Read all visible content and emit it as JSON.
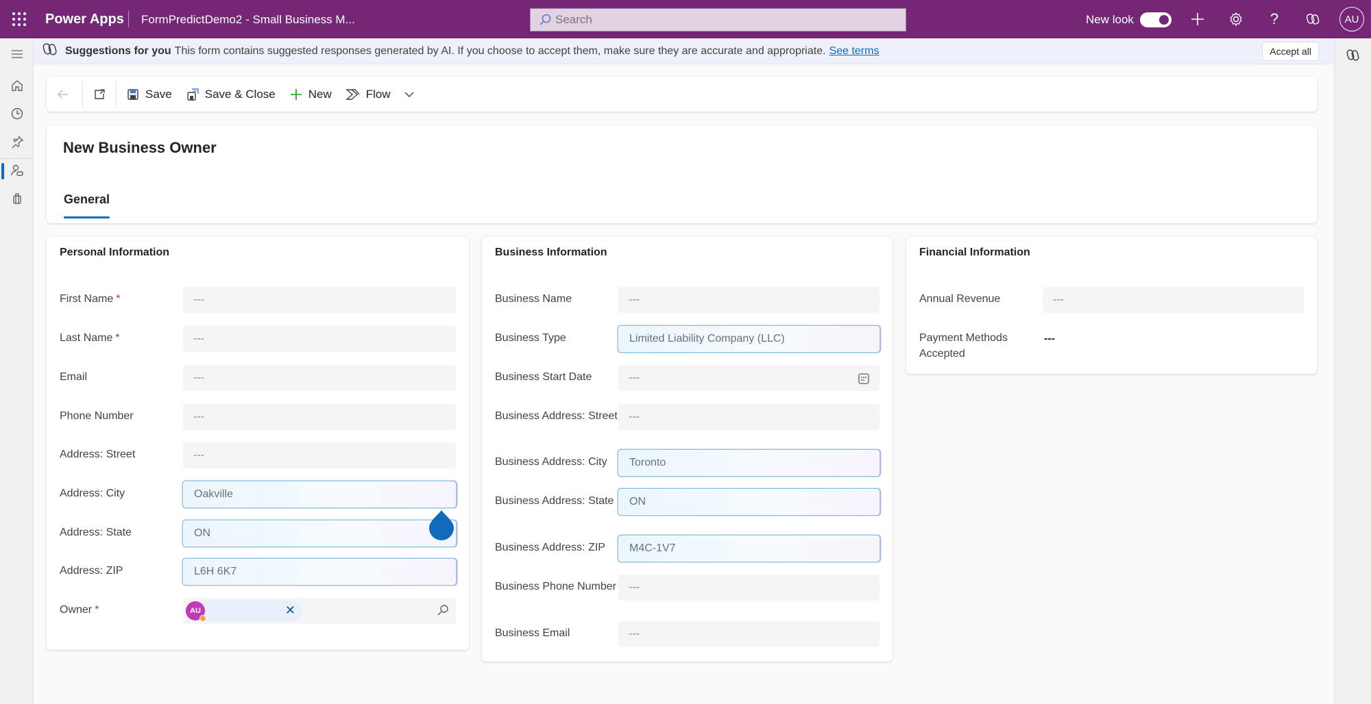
{
  "header": {
    "app_name": "Power Apps",
    "app_title": "FormPredictDemo2 - Small Business M...",
    "search_placeholder": "Search",
    "new_look_label": "New look",
    "new_look_on": true,
    "avatar_initials": "AU",
    "icons": [
      "waffle-icon",
      "plus-icon",
      "gear-icon",
      "help-icon",
      "copilot-icon"
    ]
  },
  "leftnav": {
    "items": [
      {
        "name": "menu",
        "icon": "hamburger-icon"
      },
      {
        "name": "home",
        "icon": "home-icon"
      },
      {
        "name": "recent",
        "icon": "clock-icon"
      },
      {
        "name": "pinned",
        "icon": "pin-icon"
      },
      {
        "name": "business-owners",
        "icon": "contact-icon",
        "active": true
      },
      {
        "name": "entity",
        "icon": "bag-icon"
      }
    ]
  },
  "suggestion_bar": {
    "title": "Suggestions for you",
    "text": "This form contains suggested responses generated by AI. If you choose to accept them, make sure they are accurate and appropriate.",
    "link": "See terms",
    "accept_all": "Accept all"
  },
  "toolbar": {
    "back": "Back",
    "popout": "Open in new window",
    "save": "Save",
    "save_close": "Save & Close",
    "new": "New",
    "flow": "Flow"
  },
  "form": {
    "title": "New Business Owner",
    "tabs": [
      {
        "label": "General",
        "active": true
      }
    ]
  },
  "sections": {
    "personal": {
      "title": "Personal Information",
      "fields": [
        {
          "label": "First Name",
          "required": true,
          "value": "---",
          "ai": false
        },
        {
          "label": "Last Name",
          "required": true,
          "value": "---",
          "ai": false
        },
        {
          "label": "Email",
          "required": false,
          "value": "---",
          "ai": false
        },
        {
          "label": "Phone Number",
          "required": false,
          "value": "---",
          "ai": false
        },
        {
          "label": "Address: Street",
          "required": false,
          "value": "---",
          "ai": false
        },
        {
          "label": "Address: City",
          "required": false,
          "value": "Oakville",
          "ai": true
        },
        {
          "label": "Address: State",
          "required": false,
          "value": "ON",
          "ai": true
        },
        {
          "label": "Address: ZIP",
          "required": false,
          "value": "L6H 6K7",
          "ai": true
        },
        {
          "label": "Owner",
          "required": true,
          "value": "AU",
          "ai": false
        }
      ]
    },
    "business": {
      "title": "Business Information",
      "fields": [
        {
          "label": "Business Name",
          "value": "---",
          "ai": false
        },
        {
          "label": "Business Type",
          "value": "Limited Liability Company (LLC)",
          "ai": true
        },
        {
          "label": "Business Start Date",
          "value": "---",
          "ai": false
        },
        {
          "label": "Business Address: Street",
          "value": "---",
          "ai": false
        },
        {
          "label": "Business Address: City",
          "value": "Toronto",
          "ai": true
        },
        {
          "label": "Business Address: State",
          "value": "ON",
          "ai": true
        },
        {
          "label": "Business Address: ZIP",
          "value": "M4C-1V7",
          "ai": true
        },
        {
          "label": "Business Phone Number",
          "value": "---",
          "ai": false
        },
        {
          "label": "Business Email",
          "value": "---",
          "ai": false
        }
      ]
    },
    "financial": {
      "title": "Financial Information",
      "fields": [
        {
          "label": "Annual Revenue",
          "value": "---",
          "ai": false
        },
        {
          "label": "Payment Methods Accepted",
          "value": "---",
          "ai": false
        }
      ]
    }
  },
  "owner_required_mark": "*",
  "colors": {
    "brand": "#742774",
    "accent": "#0f6cbd",
    "required": "#c4314b"
  }
}
